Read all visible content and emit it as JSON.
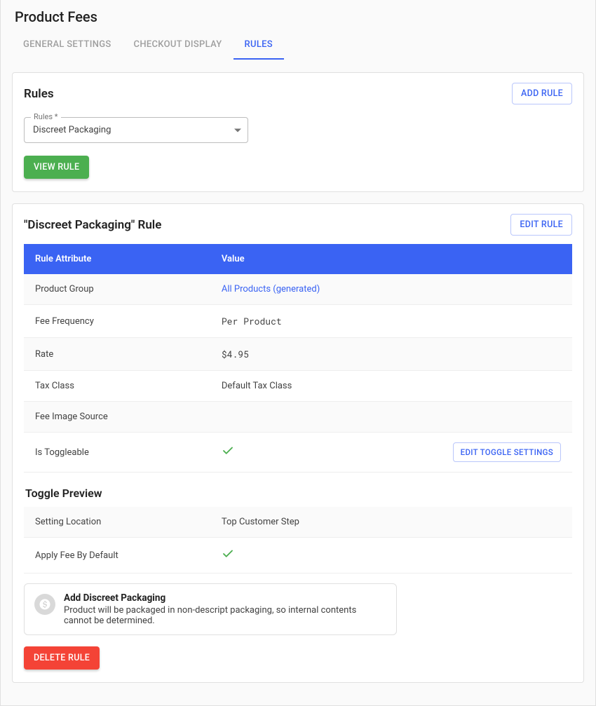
{
  "page": {
    "title": "Product Fees"
  },
  "tabs": [
    {
      "label": "GENERAL SETTINGS",
      "active": false
    },
    {
      "label": "CHECKOUT DISPLAY",
      "active": false
    },
    {
      "label": "RULES",
      "active": true
    }
  ],
  "rules_card": {
    "title": "Rules",
    "add_button": "ADD RULE",
    "select_label": "Rules *",
    "selected_rule": "Discreet Packaging",
    "view_button": "VIEW RULE"
  },
  "detail_card": {
    "title": "\"Discreet Packaging\" Rule",
    "edit_button": "EDIT RULE",
    "table_headers": {
      "attr": "Rule Attribute",
      "value": "Value"
    },
    "rows": {
      "product_group": {
        "attr": "Product Group",
        "value": "All Products (generated)",
        "link": true
      },
      "fee_frequency": {
        "attr": "Fee Frequency",
        "value": "Per Product",
        "mono": true
      },
      "rate": {
        "attr": "Rate",
        "value": "$4.95",
        "mono": true
      },
      "tax_class": {
        "attr": "Tax Class",
        "value": "Default Tax Class"
      },
      "fee_image": {
        "attr": "Fee Image Source",
        "value": ""
      },
      "toggleable": {
        "attr": "Is Toggleable",
        "check": true,
        "action": "EDIT TOGGLE SETTINGS"
      }
    },
    "toggle_preview": {
      "heading": "Toggle Preview",
      "setting_location": {
        "attr": "Setting Location",
        "value": "Top Customer Step"
      },
      "apply_default": {
        "attr": "Apply Fee By Default",
        "check": true
      }
    },
    "preview": {
      "title": "Add Discreet Packaging",
      "desc": "Product will be packaged in non-descript packaging, so internal contents cannot be determined."
    },
    "delete_button": "DELETE RULE"
  }
}
